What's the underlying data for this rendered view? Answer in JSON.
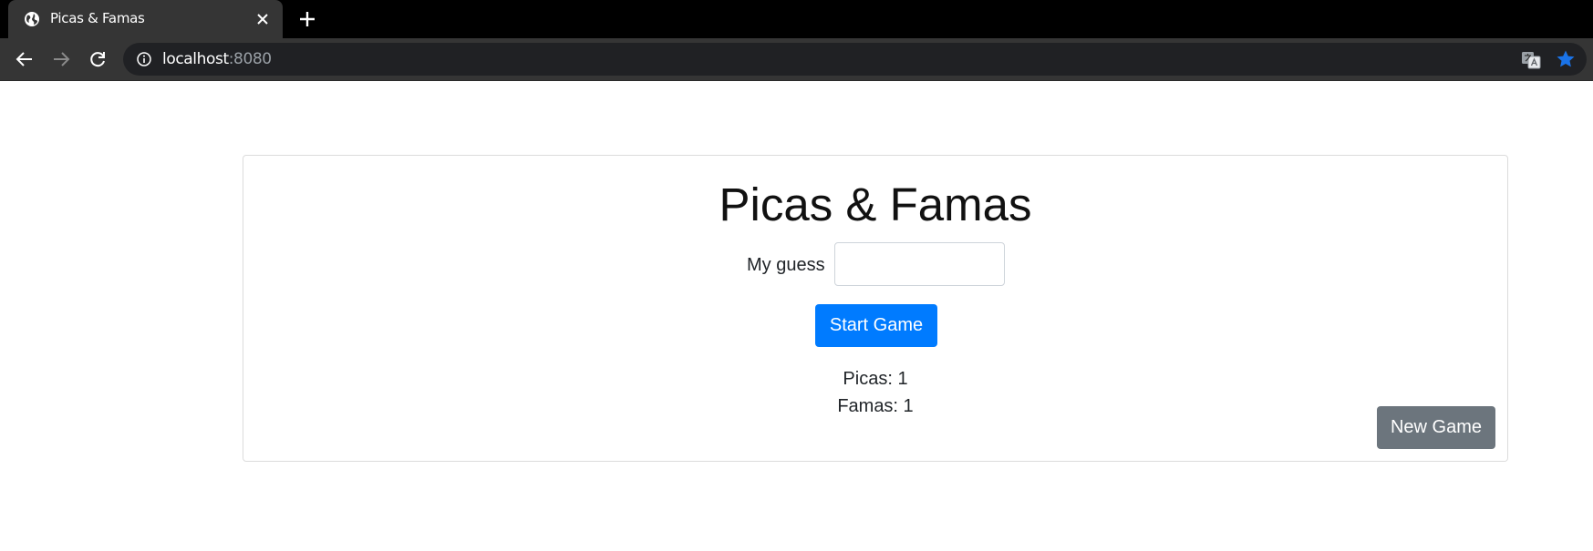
{
  "browser": {
    "tab_title": "Picas & Famas",
    "url_host": "localhost",
    "url_port": ":8080",
    "icons": {
      "favicon": "globe-icon",
      "tab_close": "close-icon",
      "new_tab": "plus-icon",
      "back": "arrow-left-icon",
      "forward": "arrow-right-icon",
      "reload": "reload-icon",
      "site_info": "info-icon",
      "translate": "translate-icon",
      "bookmark": "star-icon"
    },
    "colors": {
      "star": "#1a73e8"
    }
  },
  "page": {
    "title": "Picas & Famas",
    "guess_label": "My guess",
    "guess_value": "",
    "start_button": "Start Game",
    "picas_text": "Picas: 1",
    "famas_text": "Famas: 1",
    "new_game_button": "New Game",
    "colors": {
      "primary": "#007bff",
      "secondary": "#6c757d"
    }
  }
}
